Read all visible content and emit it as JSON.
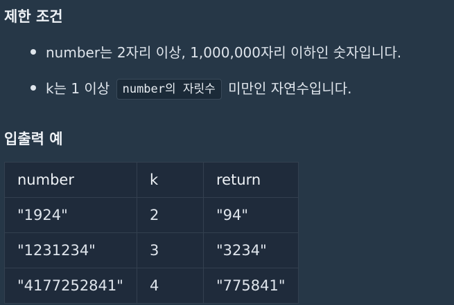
{
  "constraints": {
    "heading": "제한 조건",
    "items": [
      {
        "text": "number는 2자리 이상, 1,000,000자리 이하인 숫자입니다."
      },
      {
        "prefix": "k는 1 이상",
        "code": "number의 자릿수",
        "suffix": "미만인 자연수입니다."
      }
    ]
  },
  "io": {
    "heading": "입출력 예",
    "columns": [
      "number",
      "k",
      "return"
    ],
    "rows": [
      [
        "\"1924\"",
        "2",
        "\"94\""
      ],
      [
        "\"1231234\"",
        "3",
        "\"3234\""
      ],
      [
        "\"4177252841\"",
        "4",
        "\"775841\""
      ]
    ]
  },
  "colors": {
    "background": "#263747",
    "table_background": "#1f2b3b",
    "text": "#dfe5ec"
  }
}
